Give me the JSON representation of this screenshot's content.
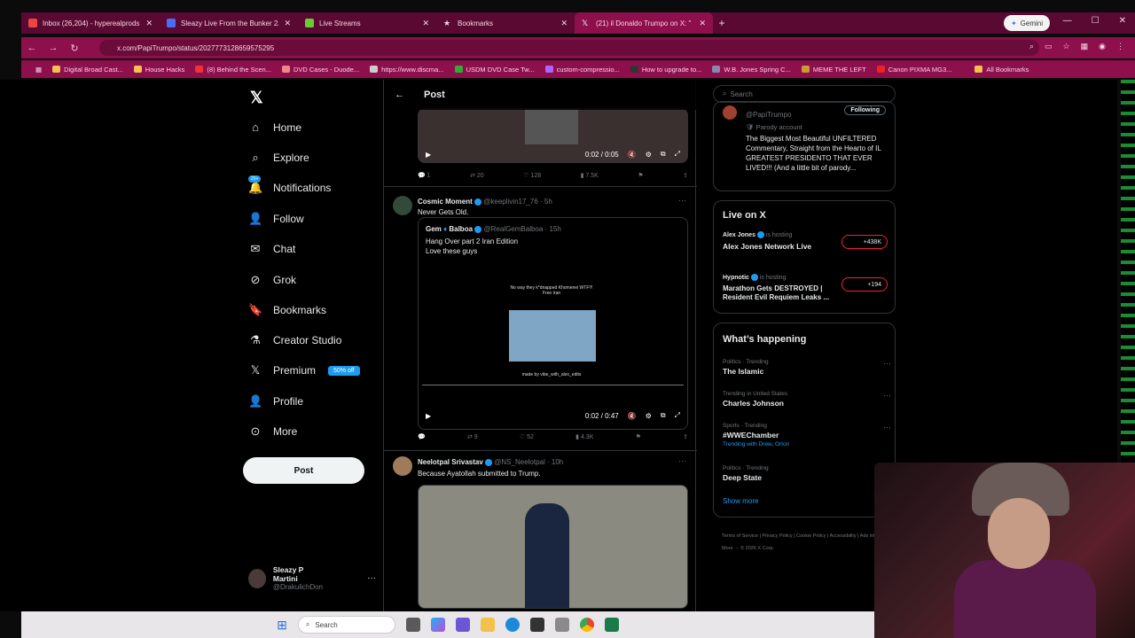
{
  "browser": {
    "tabs": [
      {
        "title": "Inbox (26,204) - hyperealprods",
        "active": false
      },
      {
        "title": "Sleazy Live From the Bunker 2/",
        "active": false
      },
      {
        "title": "Live Streams",
        "active": false
      },
      {
        "title": "Bookmarks",
        "active": false
      },
      {
        "title": "(21) il Donaldo Trumpo on X: \"",
        "active": true
      }
    ],
    "gemini_label": "Gemini",
    "url": "x.com/PapiTrumpo/status/2027773128659575295",
    "bookmarks": [
      "Digital Broad Cast...",
      "House Hacks",
      "(8) Behind the Scen...",
      "DVD Cases - Duode...",
      "https://www.discma...",
      "USDM DVD Case Tw...",
      "custom-compressio...",
      "How to upgrade to...",
      "W.B. Jones Spring C...",
      "MEME THE LEFT",
      "Canon PIXMA MG3..."
    ],
    "all_bookmarks": "All Bookmarks"
  },
  "nav": {
    "items": [
      {
        "label": "Home",
        "icon": "home-icon"
      },
      {
        "label": "Explore",
        "icon": "search-icon"
      },
      {
        "label": "Notifications",
        "icon": "bell-icon"
      },
      {
        "label": "Follow",
        "icon": "person-plus-icon"
      },
      {
        "label": "Chat",
        "icon": "mail-icon"
      },
      {
        "label": "Grok",
        "icon": "grok-icon"
      },
      {
        "label": "Bookmarks",
        "icon": "bookmark-icon"
      },
      {
        "label": "Creator Studio",
        "icon": "flask-icon"
      },
      {
        "label": "Premium",
        "icon": "x-icon"
      },
      {
        "label": "Profile",
        "icon": "person-icon"
      },
      {
        "label": "More",
        "icon": "more-circle-icon"
      }
    ],
    "notif_badge": "20+",
    "premium_tag": "50% off",
    "post_button": "Post",
    "me": {
      "name": "Sleazy P Martini",
      "handle": "@DrakulichDon"
    }
  },
  "center": {
    "header_title": "Post",
    "top_video": {
      "time": "0:02 / 0:05"
    },
    "top_actions": {
      "replies": "1",
      "reposts": "20",
      "likes": "128",
      "views": "7.5K"
    },
    "tweet1": {
      "name": "Cosmic Moment",
      "handle": "@keeplivin17_76",
      "time": "5h",
      "text": "Never Gets Old.",
      "quote": {
        "name": "Gem",
        "name2": "Balboa",
        "handle": "@RealGemBalboa",
        "time": "15h",
        "text1": "Hang Over part 2 Iran Edition",
        "text2": "Love these guys",
        "meme_top": "No way they k*dnapped Khomenei WTF!!! Free Iran",
        "meme_bottom": "made by vibe_with_alex_edits"
      },
      "video_time": "0:02 / 0:47",
      "actions": {
        "replies": "",
        "reposts": "9",
        "likes": "52",
        "views": "4.3K"
      }
    },
    "tweet2": {
      "name": "Neelotpal Srivastav",
      "handle": "@NS_Neelotpal",
      "time": "10h",
      "text": "Because Ayatollah submitted to Trump."
    }
  },
  "right": {
    "search_placeholder": "Search",
    "profile": {
      "handle": "@PapiTrumpo",
      "follow_label": "Following",
      "parody": "Parody account",
      "bio": "The Biggest Most Beautiful UNFILTERED Commentary, Straight from the Hearto of IL GREATEST PRESIDENTO THAT EVER LIVED!!! (And a little bit of parody..."
    },
    "live": {
      "title": "Live on X",
      "items": [
        {
          "host": "Alex Jones",
          "status": "is hosting",
          "title": "Alex Jones Network Live",
          "count": "+438K"
        },
        {
          "host": "Hypnotic",
          "status": "is hosting",
          "title": "Marathon Gets DESTROYED | Resident Evil Requiem Leaks ...",
          "count": "+194"
        }
      ]
    },
    "happening": {
      "title": "What’s happening",
      "trends": [
        {
          "category": "Politics · Trending",
          "title": "The Islamic",
          "extra": ""
        },
        {
          "category": "Trending in United States",
          "title": "Charles Johnson",
          "extra": ""
        },
        {
          "category": "Sports · Trending",
          "title": "#WWEChamber",
          "extra": "Trending with Drew, Orton"
        },
        {
          "category": "Politics · Trending",
          "title": "Deep State",
          "extra": ""
        }
      ],
      "show_more": "Show more"
    },
    "footer": "Terms of Service | Privacy Policy | Cookie Policy | Accessibility | Ads info | More ··· © 2026 X Corp."
  },
  "taskbar": {
    "search": "Search"
  }
}
